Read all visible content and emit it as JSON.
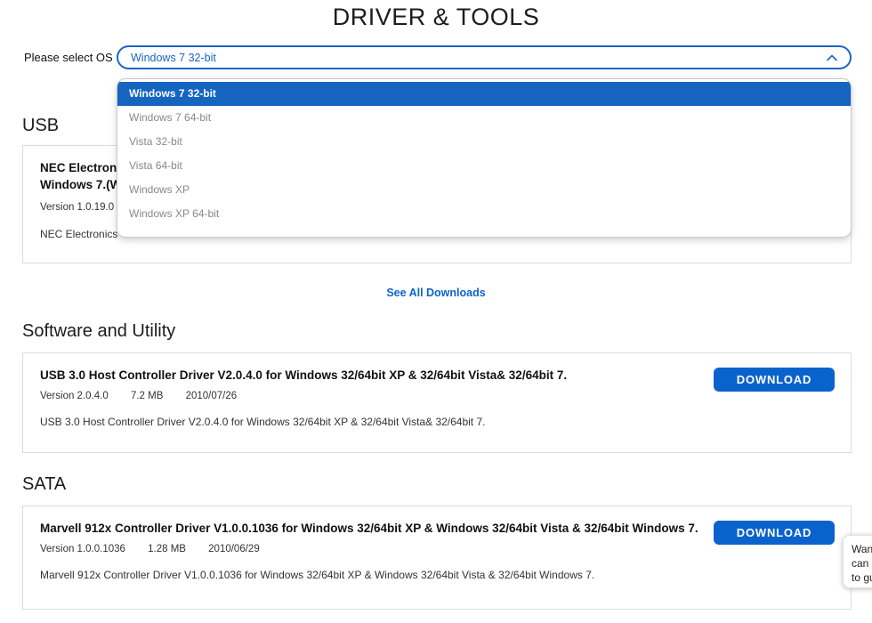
{
  "page": {
    "title": "DRIVER & TOOLS"
  },
  "colors": {
    "accent_blue": "#1666c5",
    "selected_option_bg": "#1565c0",
    "download_button_bg": "#0a63cc",
    "link_blue": "#0b63ce"
  },
  "os_select": {
    "label": "Please select OS",
    "selected": "Windows 7 32-bit",
    "chevron_icon": "chevron-up",
    "options": [
      "Windows 7 32-bit",
      "Windows 7 64-bit",
      "Vista 32-bit",
      "Vista 64-bit",
      "Windows XP",
      "Windows XP 64-bit"
    ]
  },
  "usb_section": {
    "heading": "USB",
    "card": {
      "title_line1": "NEC Electroni",
      "title_line2": "Windows 7.(W",
      "version": "Version 1.0.19.0",
      "description": "NEC Electronics C"
    }
  },
  "see_all_link": "See All Downloads",
  "software_section": {
    "heading": "Software and Utility",
    "card": {
      "title": "USB 3.0 Host Controller Driver V2.0.4.0 for Windows 32/64bit XP & 32/64bit Vista& 32/64bit 7.",
      "version": "Version 2.0.4.0",
      "size": "7.2 MB",
      "date": "2010/07/26",
      "description": "USB 3.0 Host Controller Driver V2.0.4.0 for Windows 32/64bit XP & 32/64bit Vista& 32/64bit 7.",
      "download_label": "DOWNLOAD"
    }
  },
  "sata_section": {
    "heading": "SATA",
    "card": {
      "title": "Marvell 912x Controller Driver V1.0.0.1036 for Windows 32/64bit XP & Windows 32/64bit Vista & 32/64bit Windows 7.",
      "version": "Version 1.0.0.1036",
      "size": "1.28 MB",
      "date": "2010/06/29",
      "description": "Marvell 912x Controller Driver V1.0.0.1036 for Windows 32/64bit XP & Windows 32/64bit Vista & 32/64bit Windows 7.",
      "download_label": "DOWNLOAD"
    }
  },
  "chat_popup": {
    "line1": "Wan",
    "line2": "can",
    "line3": "to gu"
  }
}
